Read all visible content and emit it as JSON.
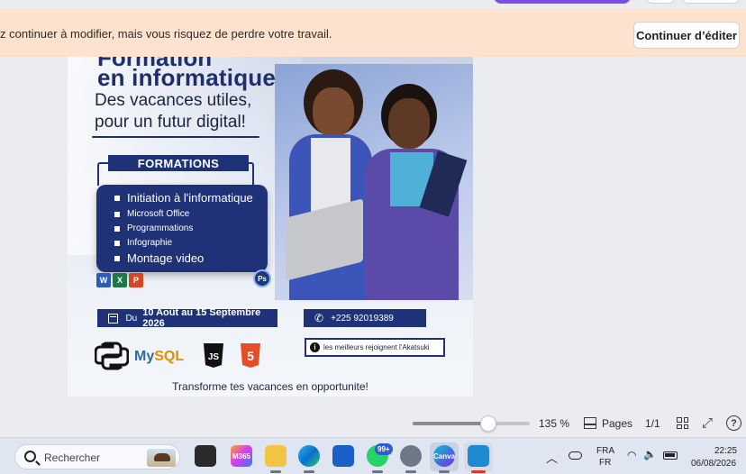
{
  "banner": {
    "message": "z continuer à modifier, mais vous risquez de perdre votre travail.",
    "continue_button": "Continuer d’éditer"
  },
  "poster": {
    "title_clipped": "Formation",
    "title": "en informatique",
    "subtitle_line1": "Des vacances utiles,",
    "subtitle_line2": "pour un futur digital!",
    "formations_label": "FORMATIONS",
    "courses": [
      {
        "label": "Initiation à l'informatique",
        "size": "big"
      },
      {
        "label": "Microsoft Office",
        "size": "sm"
      },
      {
        "label": "Programmations",
        "size": "sm"
      },
      {
        "label": "Infographie",
        "size": "sm"
      },
      {
        "label": "Montage video",
        "size": "big"
      }
    ],
    "office_icons": [
      "W",
      "X",
      "P"
    ],
    "ps_badge": "Ps",
    "date_prefix": "Du",
    "date_value": "10 Août au 15 Septembre 2026",
    "phone": "+225 92019389",
    "info": "les meilleurs rejoignent l'Akatsuki",
    "logos": {
      "mysql_my": "My",
      "mysql_sql": "SQL",
      "js": "JS",
      "html": "5"
    },
    "tagline": "Transforme tes vacances en opportunite!"
  },
  "zoom": {
    "level_percent": 135,
    "level_label": "135 %",
    "pages_label": "Pages",
    "page_count": "1/1"
  },
  "taskbar": {
    "search_placeholder": "Rechercher",
    "apps": [
      {
        "name": "copilot",
        "label": ""
      },
      {
        "name": "m365",
        "label": "M365"
      },
      {
        "name": "file-explorer",
        "label": ""
      },
      {
        "name": "edge",
        "label": ""
      },
      {
        "name": "store",
        "label": ""
      },
      {
        "name": "whatsapp",
        "label": ""
      },
      {
        "name": "settings",
        "label": ""
      },
      {
        "name": "canva",
        "label": "Canva"
      },
      {
        "name": "vscode",
        "label": ""
      }
    ],
    "whatsapp_badge": "99+",
    "language_top": "FRA",
    "language_bottom": "FR",
    "time": "22:25",
    "date": "06/08/2026"
  },
  "colors": {
    "banner_bg": "#fde3cf",
    "poster_navy": "#1f3277",
    "accent_purple": "#7b4ee4"
  }
}
